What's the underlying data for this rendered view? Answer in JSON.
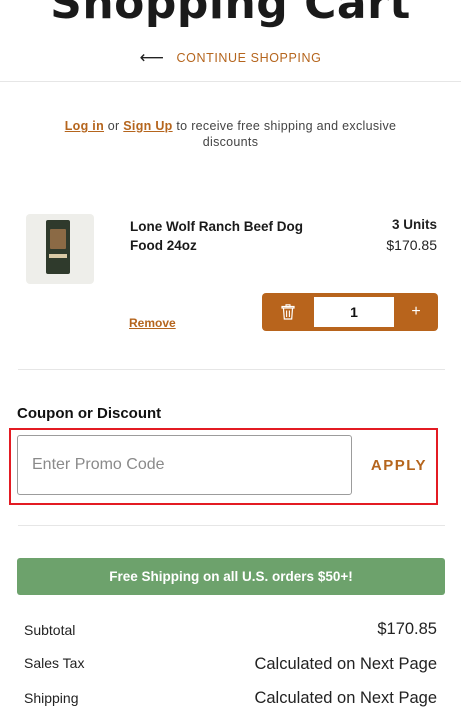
{
  "header": {
    "title": "Shopping Cart",
    "continue_label": "CONTINUE SHOPPING",
    "back_icon": "arrow-left-icon"
  },
  "login_note": {
    "login": "Log in",
    "or": "or",
    "signup": "Sign Up",
    "rest": "to receive free shipping and exclusive discounts"
  },
  "cart": {
    "item": {
      "name": "Lone Wolf Ranch Beef Dog Food 24oz",
      "units": "3 Units",
      "price": "$170.85",
      "remove_label": "Remove",
      "quantity": "1",
      "plus_label": "+",
      "trash_icon": "trash-icon"
    }
  },
  "coupon": {
    "label": "Coupon or Discount",
    "placeholder": "Enter Promo Code",
    "apply_label": "APPLY"
  },
  "banner": {
    "text": "Free Shipping on all U.S. orders $50+!"
  },
  "summary": {
    "subtotal_label": "Subtotal",
    "subtotal_value": "$170.85",
    "tax_label": "Sales Tax",
    "tax_value": "Calculated on Next Page",
    "shipping_label": "Shipping",
    "shipping_value": "Calculated on Next Page"
  },
  "colors": {
    "accent": "#b5651d",
    "stepper": "#b8641c",
    "banner": "#6da26c",
    "highlight": "#e31b23"
  }
}
